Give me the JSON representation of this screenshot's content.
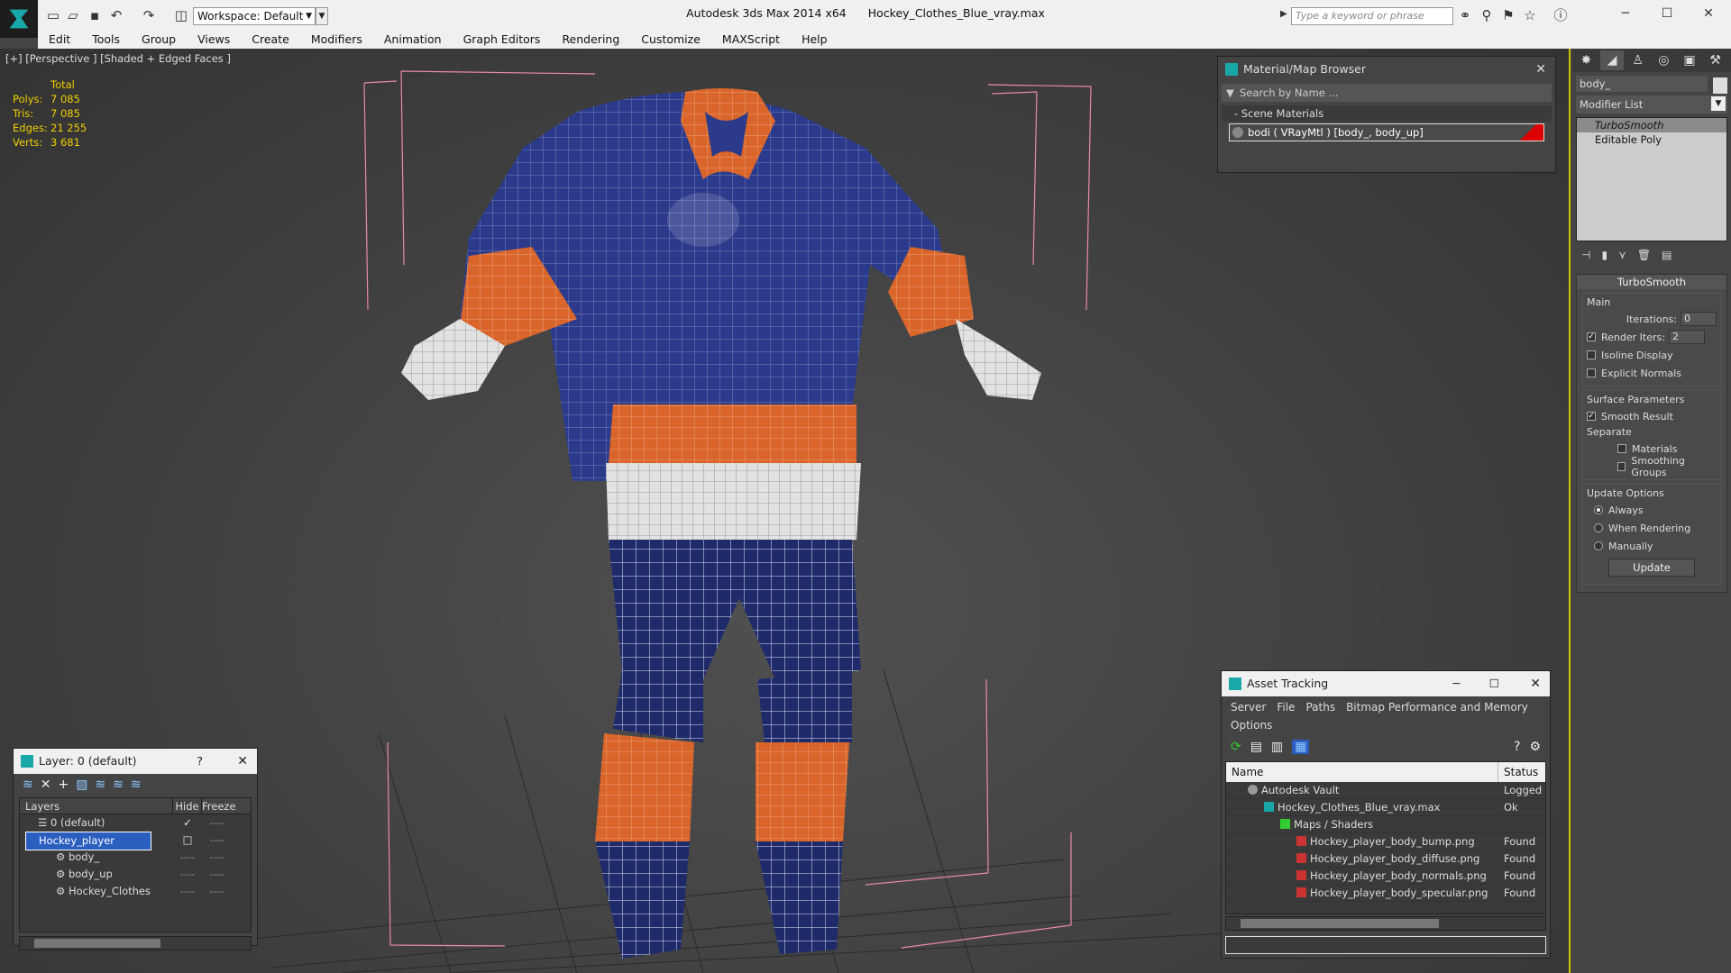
{
  "app": {
    "title": "Autodesk 3ds Max  2014 x64",
    "file": "Hockey_Clothes_Blue_vray.max",
    "workspace": "Workspace: Default",
    "search_placeholder": "Type a keyword or phrase"
  },
  "menu": [
    "Edit",
    "Tools",
    "Group",
    "Views",
    "Create",
    "Modifiers",
    "Animation",
    "Graph Editors",
    "Rendering",
    "Customize",
    "MAXScript",
    "Help"
  ],
  "viewport": {
    "label": "[+] [Perspective ] [Shaded + Edged Faces ]",
    "stats_header": "Total",
    "stats": [
      {
        "k": "Polys:",
        "v": "7 085"
      },
      {
        "k": "Tris:",
        "v": "7 085"
      },
      {
        "k": "Edges:",
        "v": "21 255"
      },
      {
        "k": "Verts:",
        "v": "3 681"
      }
    ]
  },
  "material_browser": {
    "title": "Material/Map Browser",
    "search": "Search by Name ...",
    "group": "- Scene Materials",
    "item": "bodi  ( VRayMtl ) [body_, body_up]"
  },
  "command_panel": {
    "object_name": "body_",
    "modifier_list": "Modifier List",
    "stack": [
      "TurboSmooth",
      "Editable Poly"
    ],
    "rollout_title": "TurboSmooth",
    "main": "Main",
    "iterations_label": "Iterations:",
    "iterations_value": "0",
    "render_iters_label": "Render Iters:",
    "render_iters_value": "2",
    "isoline": "Isoline Display",
    "explicit_normals": "Explicit Normals",
    "surface_params": "Surface Parameters",
    "smooth_result": "Smooth Result",
    "separate": "Separate",
    "materials": "Materials",
    "smoothing_groups": "Smoothing Groups",
    "update_options": "Update Options",
    "always": "Always",
    "when_rendering": "When Rendering",
    "manually": "Manually",
    "update_btn": "Update"
  },
  "layer_window": {
    "title": "Layer: 0 (default)",
    "help": "?",
    "col_layers": "Layers",
    "col_hide": "Hide",
    "col_freeze": "Freeze",
    "rows": [
      {
        "name": "0 (default)",
        "hide": "✓",
        "freeze": "----"
      },
      {
        "name": "Hockey_player",
        "hide": "□",
        "freeze": "----"
      },
      {
        "name": "body_",
        "hide": "----",
        "freeze": "----"
      },
      {
        "name": "body_up",
        "hide": "----",
        "freeze": "----"
      },
      {
        "name": "Hockey_Clothes",
        "hide": "----",
        "freeze": "----"
      }
    ]
  },
  "asset_tracking": {
    "title": "Asset Tracking",
    "menu": [
      "Server",
      "File",
      "Paths",
      "Bitmap Performance and Memory",
      "Options"
    ],
    "col_name": "Name",
    "col_status": "Status",
    "rows": [
      {
        "name": "Autodesk Vault",
        "status": "Logged O",
        "indent": 1
      },
      {
        "name": "Hockey_Clothes_Blue_vray.max",
        "status": "Ok",
        "indent": 2
      },
      {
        "name": "Maps / Shaders",
        "status": "",
        "indent": 3
      },
      {
        "name": "Hockey_player_body_bump.png",
        "status": "Found",
        "indent": 4
      },
      {
        "name": "Hockey_player_body_diffuse.png",
        "status": "Found",
        "indent": 4
      },
      {
        "name": "Hockey_player_body_normals.png",
        "status": "Found",
        "indent": 4
      },
      {
        "name": "Hockey_player_body_specular.png",
        "status": "Found",
        "indent": 4
      }
    ]
  },
  "colors": {
    "jersey_blue": "#2b3a8a",
    "jersey_orange": "#d9652a",
    "selection_yellow": "#c8c800",
    "accent_teal": "#18a8a8"
  }
}
